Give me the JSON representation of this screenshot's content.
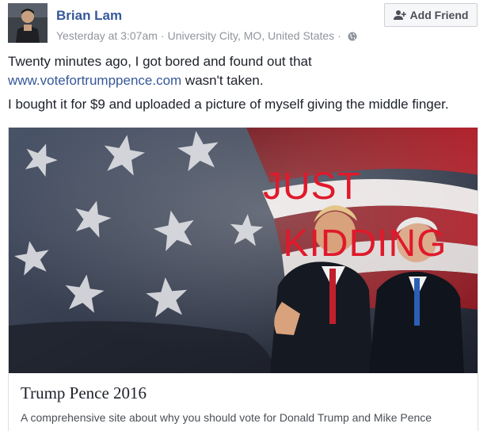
{
  "post": {
    "author": "Brian Lam",
    "timestamp": "Yesterday at 3:07am",
    "separator": "·",
    "location": "University City, MO, United States",
    "privacy_icon": "globe-icon",
    "add_friend_label": "Add Friend",
    "text_line1_before": "Twenty minutes ago, I got bored and found out that",
    "link_text": "www.votefortrumppence.com",
    "text_line2_after": " wasn't taken.",
    "paragraph2": "I bought it for $9 and uploaded a picture of myself giving the middle finger."
  },
  "card": {
    "overlay_line1": "JUST",
    "overlay_line2": "KIDDING",
    "title": "Trump Pence 2016",
    "description": "A comprehensive site about why you should vote for Donald Trump and Mike Pence"
  },
  "colors": {
    "name_link": "#365899",
    "meta": "#90949c",
    "overlay_red": "#e0192b"
  }
}
